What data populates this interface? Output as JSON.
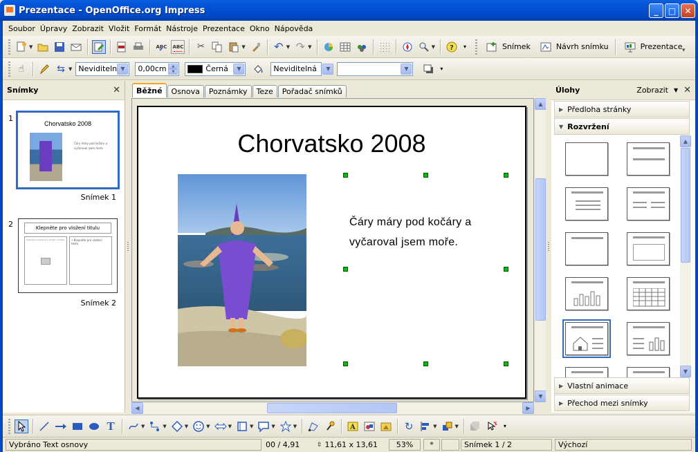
{
  "window": {
    "title": "Prezentace - OpenOffice.org Impress",
    "min": "_",
    "max": "□",
    "close": "✕"
  },
  "menu": [
    "Soubor",
    "Úpravy",
    "Zobrazit",
    "Vložit",
    "Formát",
    "Nástroje",
    "Prezentace",
    "Okno",
    "Nápověda"
  ],
  "toolbar": {
    "slide_btn": "Snímek",
    "slide_design_btn": "Návrh snímku",
    "presentation_btn": "Prezentace"
  },
  "format_bar": {
    "line_style": "Neviditelná",
    "line_width": "0,00cm",
    "line_color": "Černá",
    "area_style": "Neviditelná",
    "area_fill": ""
  },
  "slides_pane": {
    "title": "Snímky",
    "close": "✕",
    "slides": [
      {
        "num": "1",
        "label": "Snímek 1",
        "thumb_title": "Chorvatsko 2008",
        "thumb_text": "Čáry máry pod kočáry a vyčaroval jsem moře"
      },
      {
        "num": "2",
        "label": "Snímek 2",
        "thumb_title": "Klepněte pro vložení titulu",
        "thumb_left": "Klepněte dvakrát pro přidání obrázku",
        "thumb_right": "• Klepněte pro vložení textu"
      }
    ]
  },
  "tabs": [
    "Běžné",
    "Osnova",
    "Poznámky",
    "Teze",
    "Pořadač snímků"
  ],
  "slide": {
    "title": "Chorvatsko 2008",
    "text": "Čáry máry pod kočáry a vyčaroval jsem moře."
  },
  "tasks_pane": {
    "title": "Úlohy",
    "view": "Zobrazit",
    "close": "✕",
    "sections": {
      "master_pages": "Předloha stránky",
      "layouts": "Rozvržení",
      "custom_animation": "Vlastní animace",
      "slide_transition": "Přechod mezi snímky"
    }
  },
  "statusbar": {
    "message": "Vybráno Text osnovy",
    "position": "00 / 4,91",
    "size": "11,61 x 13,61",
    "zoom": "53%",
    "modified": "*",
    "slide": "Snímek 1 / 2",
    "master": "Výchozí"
  },
  "colors": {
    "accent": "#316ac5",
    "handle": "#00c000",
    "titlebar": "#0049c6"
  }
}
